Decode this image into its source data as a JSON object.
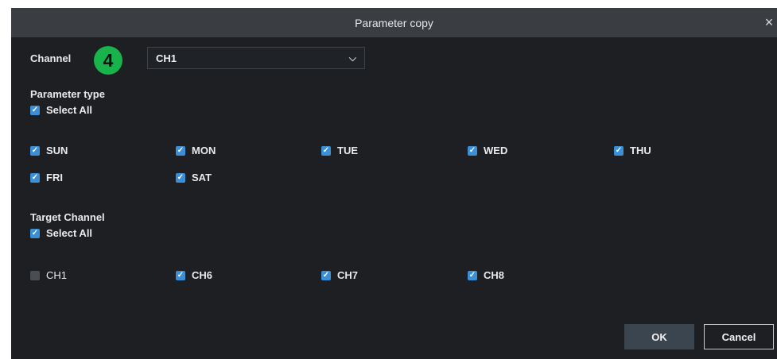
{
  "dialog": {
    "title": "Parameter copy",
    "close_glyph": "×",
    "channel_label": "Channel",
    "step_badge": "4",
    "channel_select": {
      "value": "CH1",
      "chevron_glyph": "⌵"
    },
    "parameter_type": {
      "label": "Parameter type",
      "select_all": {
        "label": "Select All",
        "checked": true
      },
      "days": [
        {
          "label": "SUN",
          "checked": true
        },
        {
          "label": "MON",
          "checked": true
        },
        {
          "label": "TUE",
          "checked": true
        },
        {
          "label": "WED",
          "checked": true
        },
        {
          "label": "THU",
          "checked": true
        },
        {
          "label": "FRI",
          "checked": true
        },
        {
          "label": "SAT",
          "checked": true
        }
      ]
    },
    "target_channel": {
      "label": "Target Channel",
      "select_all": {
        "label": "Select All",
        "checked": true
      },
      "channels": [
        {
          "label": "CH1",
          "checked": false
        },
        {
          "label": "CH6",
          "checked": true
        },
        {
          "label": "CH7",
          "checked": true
        },
        {
          "label": "CH8",
          "checked": true
        }
      ]
    },
    "buttons": {
      "ok": "OK",
      "cancel": "Cancel"
    },
    "colors": {
      "accent_checkbox": "#3b8fd6",
      "badge_green": "#19b34c",
      "dialog_bg": "#1d1f23",
      "titlebar_bg": "#3a3d42"
    }
  }
}
